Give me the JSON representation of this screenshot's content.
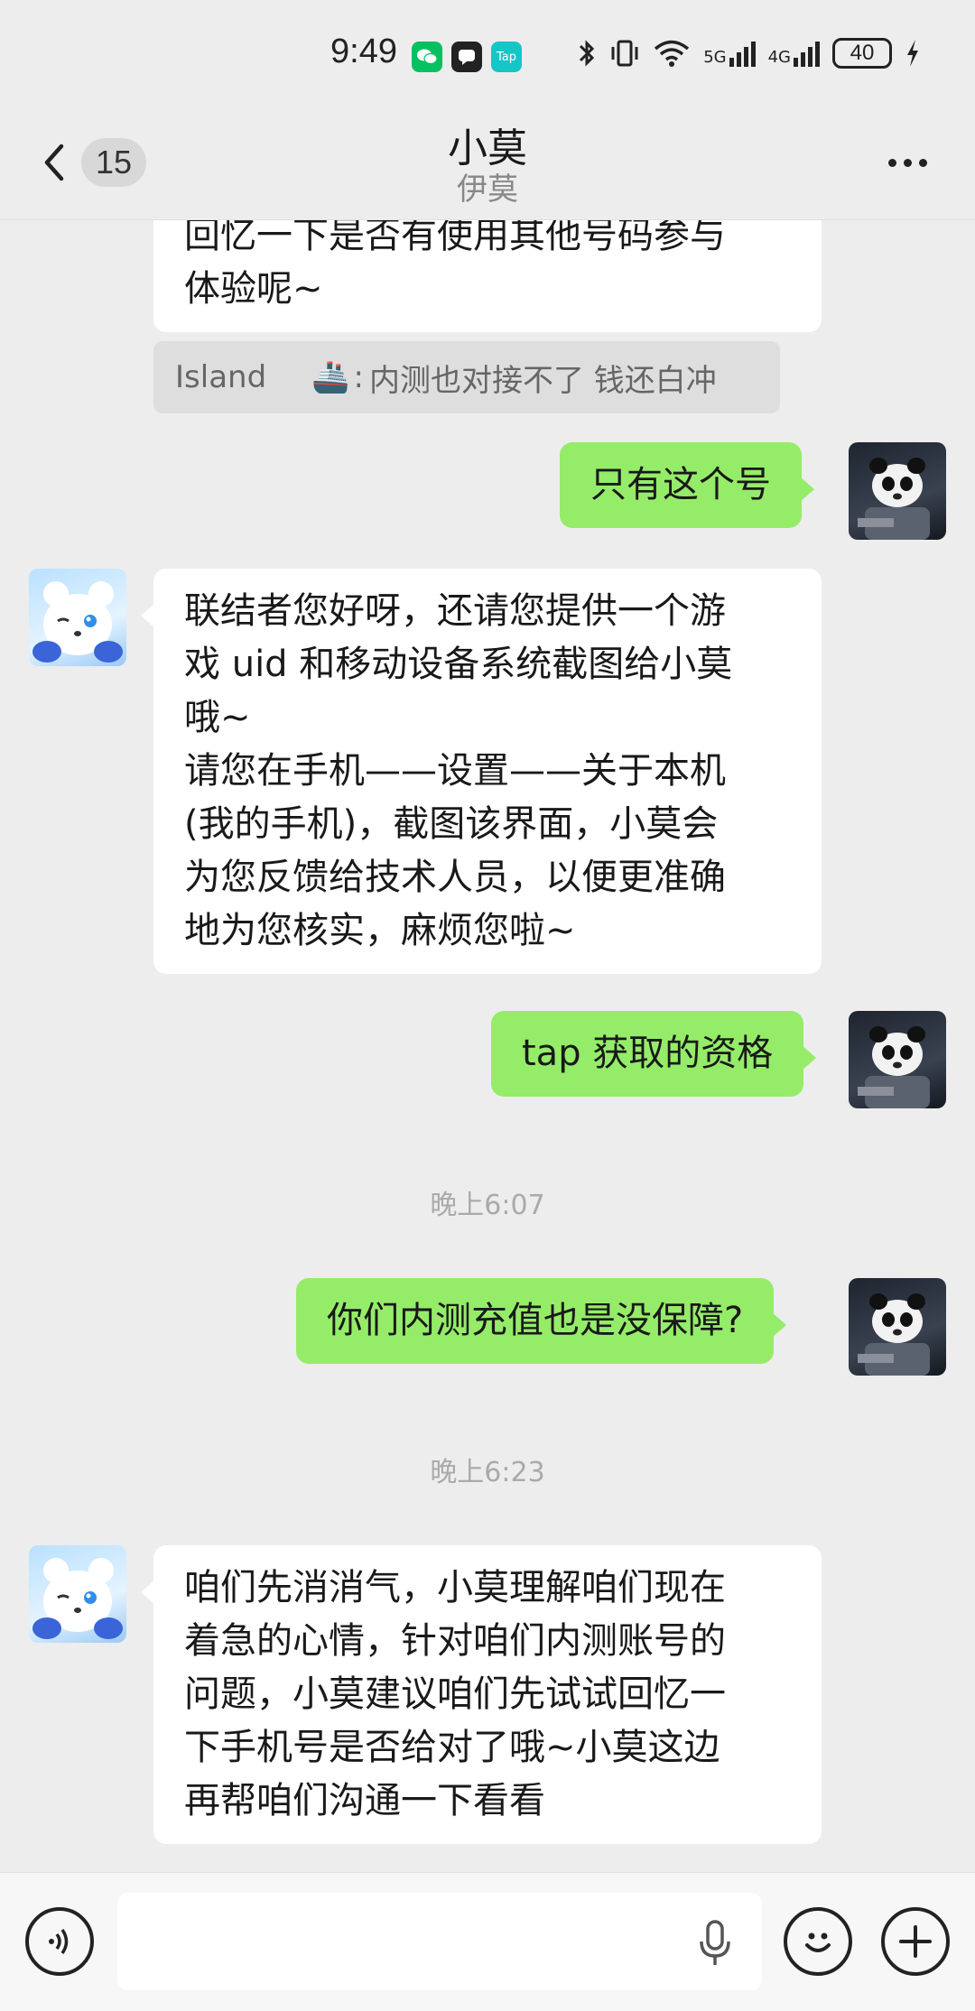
{
  "status_bar": {
    "time": "9:49",
    "apps": [
      {
        "icon": "wechat-icon",
        "color": "#07c160"
      },
      {
        "icon": "message-icon",
        "color": "#222222"
      },
      {
        "icon": "taptap-icon",
        "color": "#16c5c5",
        "label": "Tap"
      }
    ],
    "network_1": "5G",
    "network_2": "4G",
    "battery": "40"
  },
  "header": {
    "unread_count": "15",
    "title": "小莫",
    "subtitle": "伊莫"
  },
  "messages": [
    {
      "side": "in",
      "text_lines": [
        "回忆一下是否有使用其他号码参与",
        "体验呢~"
      ]
    },
    {
      "type": "quote",
      "sender": "Island",
      "emoji": "🚢",
      "text": "内测也对接不了 钱还白冲"
    },
    {
      "side": "out",
      "text": "只有这个号"
    },
    {
      "side": "in",
      "text_lines": [
        "联结者您好呀，还请您提供一个游",
        "戏 uid 和移动设备系统截图给小莫",
        "哦~",
        "请您在手机——设置——关于本机",
        "(我的手机)，截图该界面，小莫会",
        "为您反馈给技术人员，以便更准确",
        "地为您核实，麻烦您啦~"
      ]
    },
    {
      "side": "out",
      "text": "tap 获取的资格"
    },
    {
      "type": "time",
      "text": "晚上6:07"
    },
    {
      "side": "out",
      "text": "你们内测充值也是没保障?"
    },
    {
      "type": "time",
      "text": "晚上6:23"
    },
    {
      "side": "in",
      "text_lines": [
        "咱们先消消气，小莫理解咱们现在",
        "着急的心情，针对咱们内测账号的",
        "问题，小莫建议咱们先试试回忆一",
        "下手机号是否给对了哦~小莫这边",
        "再帮咱们沟通一下看看"
      ]
    }
  ],
  "input_bar": {
    "placeholder": ""
  }
}
